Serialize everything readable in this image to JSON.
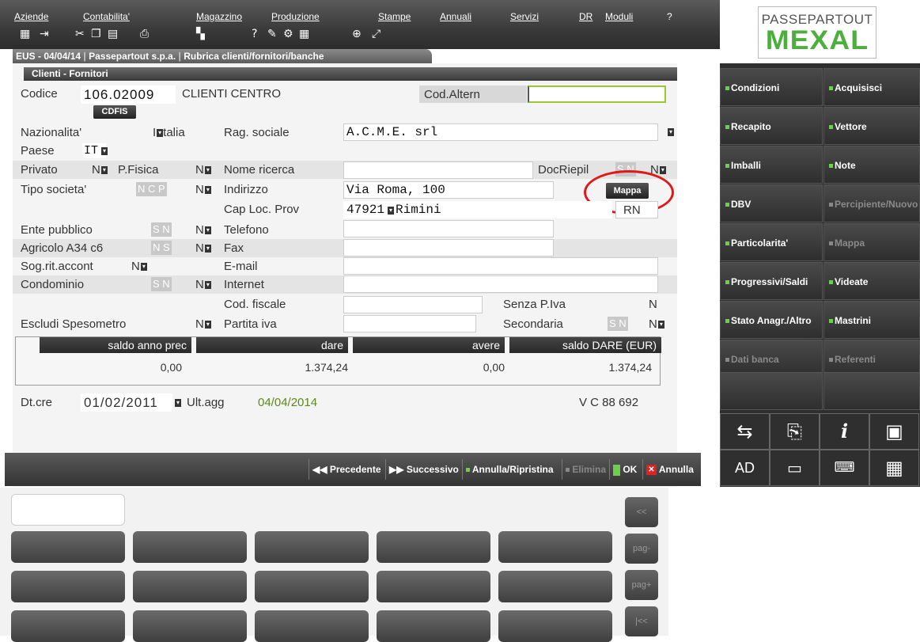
{
  "menu": [
    "Aziende",
    "Contabilita'",
    "Magazzino",
    "Produzione",
    "Stampe",
    "Annuali",
    "Servizi",
    "DR",
    "Moduli",
    "?"
  ],
  "toolbar_icons": [
    "grid-icon",
    "exit-icon",
    "scissors-icon",
    "copy-icon",
    "paste-icon",
    "print-icon",
    "notes-icon",
    "help-icon",
    "calc-icon",
    "tools-icon",
    "calendar-icon",
    "fullscreen-icon",
    "expand-icon"
  ],
  "breadcrumb": {
    "part1": "EUS - 04/04/14",
    "part2": "Passepartout s.p.a.",
    "part3": "Rubrica clienti/fornitori/banche"
  },
  "logo": {
    "line1": "PASSEPARTOUT",
    "line2": "MEXAL"
  },
  "panel_title": "Clienti - Fornitori",
  "codice": {
    "label": "Codice",
    "value": "106.02009",
    "desc": "CLIENTI CENTRO",
    "cdfis": "CDFIS"
  },
  "cod_altern": {
    "label": "Cod.Altern",
    "value": ""
  },
  "nazionalita": {
    "label": "Nazionalita'",
    "value": "I",
    "text": "talia"
  },
  "rag_sociale": {
    "label": "Rag. sociale",
    "value": "A.C.M.E. srl"
  },
  "paese": {
    "label": "Paese",
    "value": "IT"
  },
  "privato": {
    "label": "Privato",
    "value": "N"
  },
  "pfisica": {
    "label": "P.Fisica",
    "value": "N"
  },
  "nome_ricerca": {
    "label": "Nome ricerca",
    "value": ""
  },
  "docriepil": {
    "label": "DocRiepil",
    "value": "N",
    "opts": "S N"
  },
  "tipo_societa": {
    "label": "Tipo societa'",
    "opts": "N C P",
    "value": "N"
  },
  "indirizzo": {
    "label": "Indirizzo",
    "value": "Via Roma, 100"
  },
  "mappa_button": "Mappa",
  "cap": {
    "label": "Cap Loc. Prov",
    "cap": "47921",
    "loc": "Rimini",
    "prov": "RN"
  },
  "ente_pubblico": {
    "label": "Ente pubblico",
    "opts": "S N",
    "value": "N"
  },
  "telefono": {
    "label": "Telefono",
    "value": ""
  },
  "agricolo": {
    "label": "Agricolo A34 c6",
    "opts": "N S",
    "value": "N"
  },
  "fax": {
    "label": "Fax",
    "value": ""
  },
  "sog_rit": {
    "label": "Sog.rit.accont",
    "value": "N"
  },
  "email": {
    "label": "E-mail",
    "value": ""
  },
  "condominio": {
    "label": "Condominio",
    "opts": "S N",
    "value": "N"
  },
  "internet": {
    "label": "Internet",
    "value": ""
  },
  "cod_fiscale": {
    "label": "Cod. fiscale",
    "value": ""
  },
  "senza_piva": {
    "label": "Senza P.Iva",
    "value": "N"
  },
  "escludi": {
    "label": "Escludi Spesometro",
    "value": "N"
  },
  "partita_iva": {
    "label": "Partita iva",
    "value": ""
  },
  "secondaria": {
    "label": "Secondaria",
    "opts": "S N",
    "value": "N"
  },
  "totals": {
    "headers": [
      "saldo anno prec",
      "dare",
      "avere",
      "saldo DARE (EUR)"
    ],
    "values": [
      "0,00",
      "1.374,24",
      "0,00",
      "1.374,24"
    ]
  },
  "dtcre": {
    "label": "Dt.cre",
    "value": "01/02/2011",
    "ultagg_label": "Ult.agg",
    "ultagg": "04/04/2014",
    "code": "V C 88 692"
  },
  "bottom_buttons": [
    {
      "label": "Precedente",
      "enabled": true
    },
    {
      "label": "Successivo",
      "enabled": true
    },
    {
      "label": "Annulla/Ripristina",
      "enabled": true
    },
    {
      "label": "Elimina",
      "enabled": false
    },
    {
      "label": "OK",
      "enabled": true
    },
    {
      "label": "Annulla",
      "enabled": true
    }
  ],
  "keyboard_nav": [
    "<<",
    "pag-",
    "pag+",
    "|<<"
  ],
  "sidebar": [
    {
      "label": "Condizioni",
      "enabled": true
    },
    {
      "label": "Acquisisci",
      "enabled": true
    },
    {
      "label": "Recapito",
      "enabled": true
    },
    {
      "label": "Vettore",
      "enabled": true
    },
    {
      "label": "Imballi",
      "enabled": true
    },
    {
      "label": "Note",
      "enabled": true
    },
    {
      "label": "DBV",
      "enabled": true
    },
    {
      "label": "Percipiente/Nuovo",
      "enabled": false
    },
    {
      "label": "Particolarita'",
      "enabled": true
    },
    {
      "label": "Mappa",
      "enabled": false
    },
    {
      "label": "Progressivi/Saldi",
      "enabled": true
    },
    {
      "label": "Videate",
      "enabled": true
    },
    {
      "label": "Stato Anagr./Altro",
      "enabled": true
    },
    {
      "label": "Mastrini",
      "enabled": true
    },
    {
      "label": "Dati banca",
      "enabled": false
    },
    {
      "label": "Referenti",
      "enabled": false
    }
  ],
  "iconbar": {
    "ad_label": "AD",
    "icons": [
      "sync-icon",
      "search-doc-icon",
      "info-icon",
      "play-icon",
      "ad-icon",
      "card-icon",
      "keyboard-icon",
      "apps-icon"
    ]
  }
}
